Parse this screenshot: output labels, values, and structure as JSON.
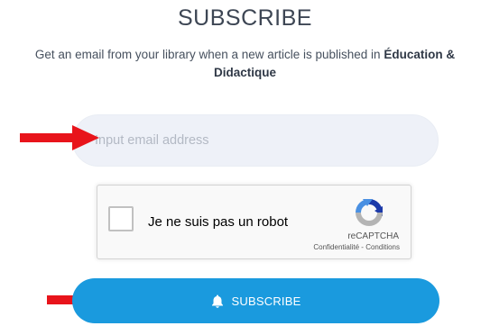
{
  "header": {
    "title": "SUBSCRIBE",
    "description": "Get an email from your library when a new article is published in",
    "journal_name": "Éducation & Didactique"
  },
  "form": {
    "email_placeholder": "Input email address",
    "email_value": ""
  },
  "captcha": {
    "label": "Je ne suis pas un robot",
    "brand": "reCAPTCHA",
    "privacy_link": "Confidentialité",
    "separator": " - ",
    "terms_link": "Conditions",
    "checked": false
  },
  "subscribe_button": {
    "label": "SUBSCRIBE",
    "icon": "bell-icon"
  },
  "annotations": {
    "arrow_color": "#e8141b"
  },
  "colors": {
    "accent": "#1a9ade",
    "title": "#3d4654",
    "input_bg": "#eef1f8"
  }
}
